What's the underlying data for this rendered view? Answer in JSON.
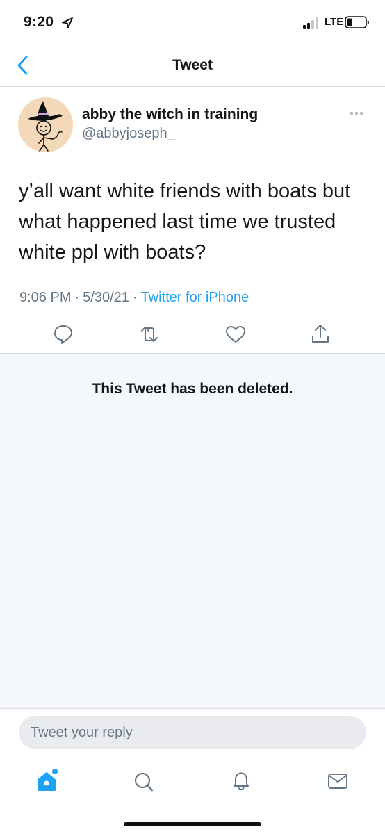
{
  "status_bar": {
    "time": "9:20",
    "network": "LTE",
    "location_icon": "location-arrow-icon",
    "signal_icon": "signal-bars-icon",
    "battery_icon": "battery-icon"
  },
  "nav": {
    "title": "Tweet",
    "back_icon": "chevron-left-icon"
  },
  "tweet": {
    "display_name": "abby the witch in training",
    "handle": "@abbyjoseph_",
    "text": "y’all want white friends with boats but what happened last time we trusted white ppl with boats?",
    "time": "9:06 PM",
    "date": "5/30/21",
    "separator": "·",
    "source": "Twitter for iPhone",
    "actions": [
      "reply-icon",
      "retweet-icon",
      "like-icon",
      "share-icon"
    ]
  },
  "deleted_notice": "This Tweet has been deleted.",
  "reply": {
    "placeholder": "Tweet your reply"
  },
  "tab_bar": {
    "items": [
      "home-icon",
      "search-icon",
      "notifications-icon",
      "messages-icon"
    ],
    "home_has_badge": true
  },
  "colors": {
    "accent": "#1da1f2",
    "secondary_text": "#657786",
    "divider": "#d9dde1",
    "deleted_bg": "#f5f8fa",
    "reply_bg": "#e9ebee"
  }
}
